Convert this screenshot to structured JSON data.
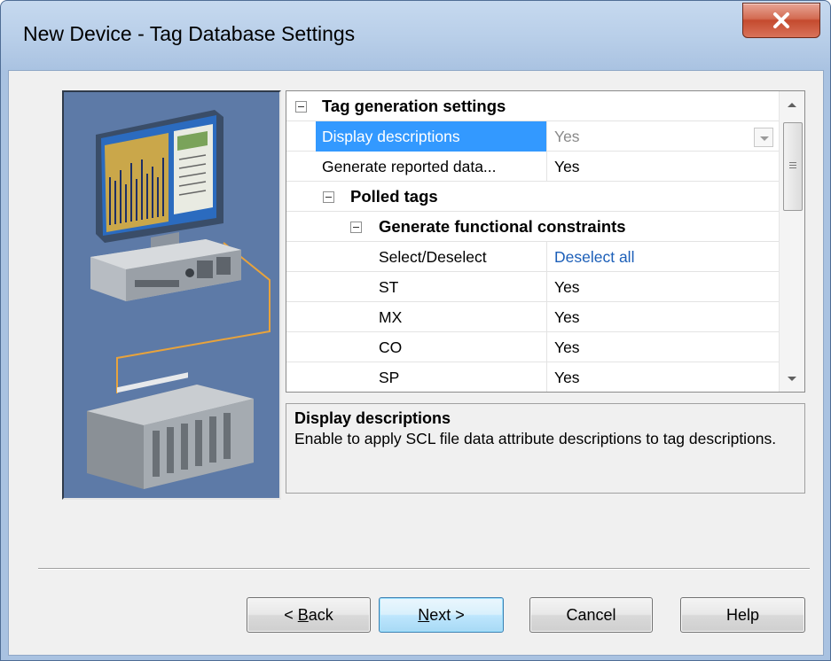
{
  "window": {
    "title": "New Device - Tag Database Settings",
    "close_glyph": "X"
  },
  "property_grid": {
    "rows": [
      {
        "type": "category",
        "indent": 0,
        "name": "Tag generation settings"
      },
      {
        "type": "property",
        "indent": 0,
        "name": "Display descriptions",
        "value": "Yes",
        "selected": true,
        "has_dropdown": true
      },
      {
        "type": "property",
        "indent": 0,
        "name": "Generate reported data...",
        "value": "Yes"
      },
      {
        "type": "category",
        "indent": 1,
        "name": "Polled tags"
      },
      {
        "type": "category",
        "indent": 2,
        "name": "Generate functional constraints"
      },
      {
        "type": "property",
        "indent": 2,
        "name": "Select/Deselect",
        "value": "Deselect all",
        "link": true
      },
      {
        "type": "property",
        "indent": 2,
        "name": "ST",
        "value": "Yes"
      },
      {
        "type": "property",
        "indent": 2,
        "name": "MX",
        "value": "Yes"
      },
      {
        "type": "property",
        "indent": 2,
        "name": "CO",
        "value": "Yes"
      },
      {
        "type": "property",
        "indent": 2,
        "name": "SP",
        "value": "Yes"
      }
    ]
  },
  "description": {
    "title": "Display descriptions",
    "text": "Enable to apply SCL file data attribute descriptions to tag descriptions."
  },
  "buttons": {
    "back_prefix": "< ",
    "back_mnemonic": "B",
    "back_rest": "ack",
    "next_mnemonic": "N",
    "next_rest": "ext >",
    "cancel": "Cancel",
    "help": "Help"
  },
  "colors": {
    "selection": "#3399ff",
    "link": "#1c5fb8",
    "close_button": "#c44a2e"
  }
}
